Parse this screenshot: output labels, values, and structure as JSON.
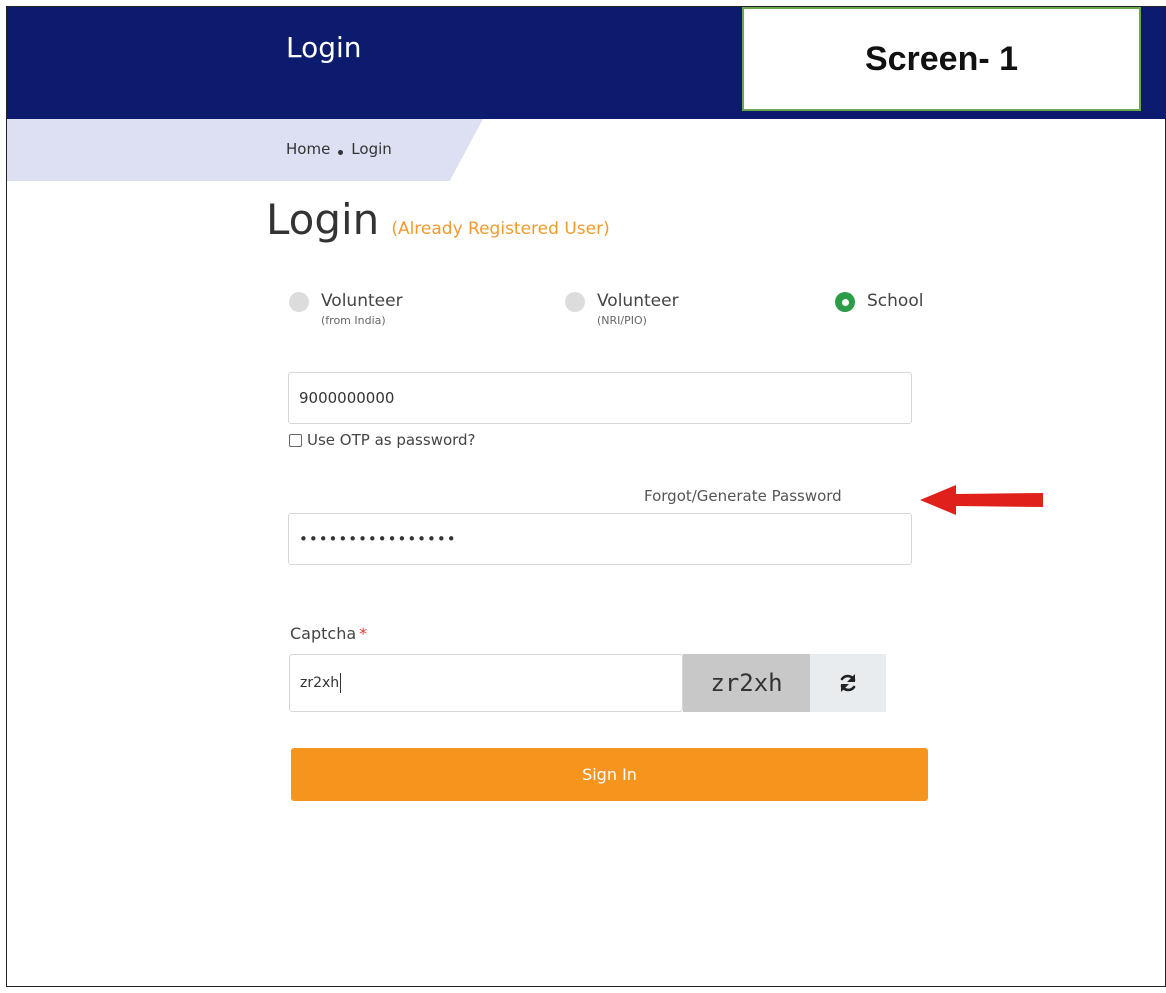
{
  "header": {
    "title": "Login"
  },
  "annotation": {
    "screen_label": "Screen- 1"
  },
  "breadcrumb": {
    "home": "Home",
    "current": "Login"
  },
  "page": {
    "title": "Login",
    "subtitle": "(Already Registered User)"
  },
  "login_type": {
    "selected": "School",
    "options": [
      {
        "label": "Volunteer",
        "sub": "(from India)",
        "selected": false
      },
      {
        "label": "Volunteer",
        "sub": "(NRI/PIO)",
        "selected": false
      },
      {
        "label": "School",
        "sub": "",
        "selected": true
      }
    ]
  },
  "form": {
    "username_value": "9000000000",
    "otp_label": "Use OTP as password?",
    "forgot_label": "Forgot/Generate Password",
    "password_value": "••••••••••••••••",
    "captcha_label": "Captcha",
    "captcha_required": "*",
    "captcha_value": "zr2xh",
    "captcha_text": "zr2xh",
    "signin_label": "Sign In"
  },
  "colors": {
    "header": "#0d1b6e",
    "accent": "#f5951d",
    "selected_radio": "#2d9c48",
    "arrow": "#e0211b",
    "annotation_border": "#6aa84f"
  },
  "icons": {
    "refresh": "refresh-icon",
    "arrow": "arrow-left-icon"
  }
}
